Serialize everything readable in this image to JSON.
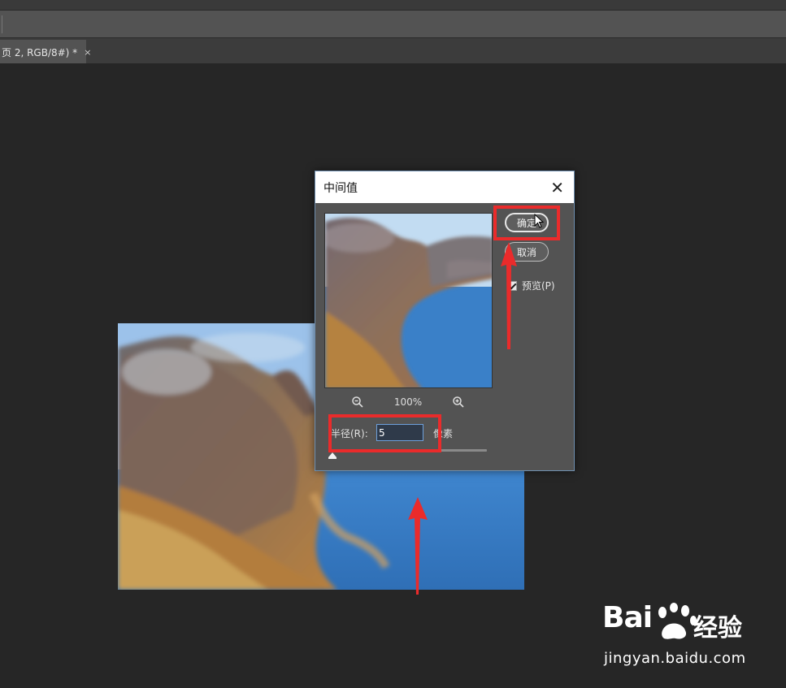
{
  "document": {
    "tab_title": "页 2, RGB/8#) *",
    "tab_close": "×"
  },
  "dialog": {
    "title": "中间值",
    "close_glyph": "✕",
    "ok_label": "确定",
    "cancel_label": "取消",
    "preview_label": "预览(P)",
    "preview_checked": true,
    "zoom_level": "100%",
    "radius_label": "半径(R):",
    "radius_value": "5",
    "unit_label": "像素",
    "slider_value": 5
  },
  "watermark": {
    "brand_prefix": "Bai",
    "brand_suffix": "经验",
    "url": "jingyan.baidu.com"
  },
  "colors": {
    "annotation": "#ea2b2b",
    "water": "#3a7cc4",
    "dialog_bg": "#535353",
    "canvas_bg": "#262626"
  }
}
